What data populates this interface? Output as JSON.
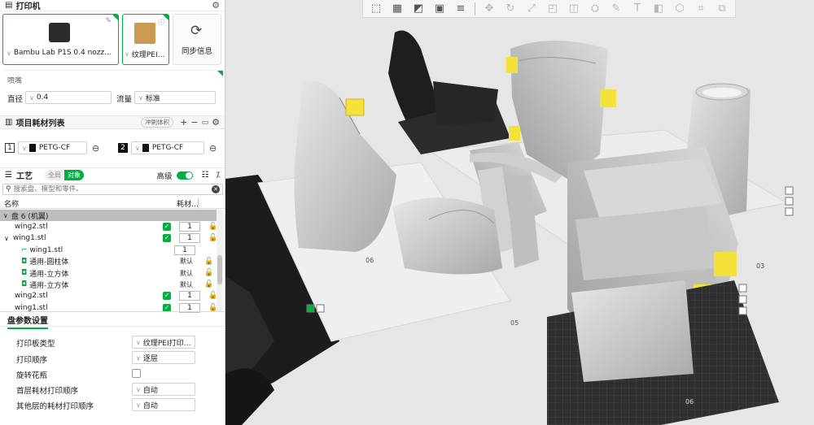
{
  "printer": {
    "section_title": "打印机",
    "printer_name": "Bambu Lab P1S 0.4 nozz…",
    "plate_name": "纹理PEI…",
    "sync_label": "同步信息"
  },
  "nozzle": {
    "title": "喷嘴",
    "diameter_label": "直径",
    "diameter_value": "0.4",
    "flow_label": "流量",
    "flow_value": "标准"
  },
  "filaments": {
    "section_title": "项目耗材列表",
    "flush_label": "冲刷体积",
    "items": [
      {
        "index": "1",
        "name": "PETG-CF"
      },
      {
        "index": "2",
        "name": "PETG-CF"
      }
    ]
  },
  "process": {
    "section_title": "工艺",
    "tab_global": "全局",
    "tab_object": "对象",
    "advanced_label": "高级",
    "search_placeholder": "搜索盘、模型和零件。",
    "col_name": "名称",
    "col_filament": "耗材…"
  },
  "tree": {
    "plate_label": "盘 6 (机翼)",
    "rows": [
      {
        "name": "wing2.stl",
        "value": "1"
      },
      {
        "name": "wing1.stl",
        "value": "1"
      },
      {
        "name": "wing1.stl",
        "value": "1"
      },
      {
        "name": "通用-圆柱体",
        "value": "默认"
      },
      {
        "name": "通用-立方体",
        "value": "默认"
      },
      {
        "name": "通用-立方体",
        "value": "默认"
      },
      {
        "name": "wing2.stl",
        "value": "1"
      },
      {
        "name": "wing1.stl",
        "value": "1"
      }
    ]
  },
  "plate_settings": {
    "title": "盘参数设置",
    "rows": [
      {
        "label": "打印板类型",
        "value": "纹理PEI打印…"
      },
      {
        "label": "打印顺序",
        "value": "逐层"
      },
      {
        "label": "旋转花瓶",
        "value": ""
      },
      {
        "label": "首层耗材打印顺序",
        "value": "自动"
      },
      {
        "label": "其他层的耗材打印顺序",
        "value": "自动"
      }
    ]
  },
  "viewport": {
    "plate_labels": [
      "06",
      "05",
      "03",
      "06"
    ]
  },
  "colors": {
    "accent": "#00ae42",
    "model_gray": "#c9c9c9",
    "support_yellow": "#f2e23a",
    "plate_dark": "#2f2f2f"
  }
}
